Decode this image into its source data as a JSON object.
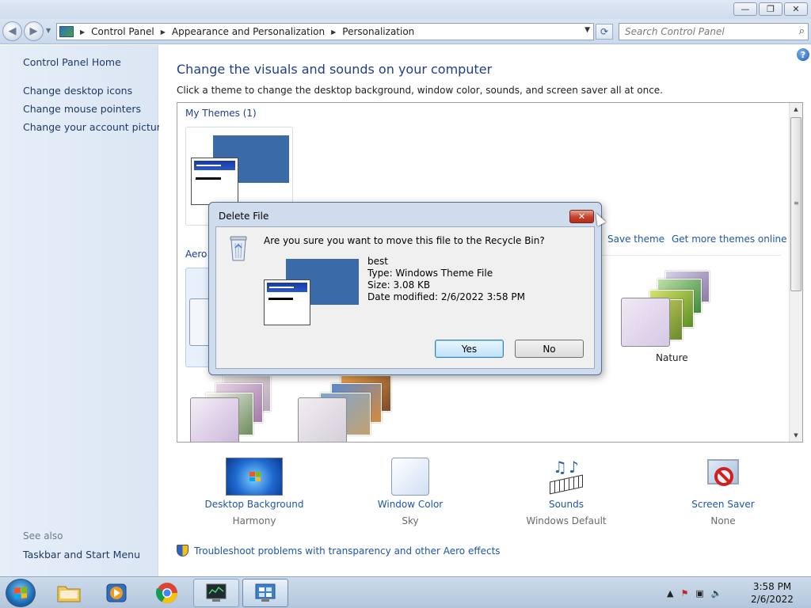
{
  "window": {
    "minimize_glyph": "—",
    "maximize_glyph": "❐",
    "close_glyph": "✕"
  },
  "address": {
    "crumbs": [
      "Control Panel",
      "Appearance and Personalization",
      "Personalization"
    ],
    "search_placeholder": "Search Control Panel"
  },
  "sidebar": {
    "home": "Control Panel Home",
    "links": [
      "Change desktop icons",
      "Change mouse pointers",
      "Change your account picture"
    ],
    "see_also_label": "See also",
    "see_also_links": [
      "Taskbar and Start Menu"
    ]
  },
  "main": {
    "help_glyph": "?",
    "title": "Change the visuals and sounds on your computer",
    "subtitle": "Click a theme to change the desktop background, window color, sounds, and screen saver all at once.",
    "my_themes_header": "My Themes (1)",
    "aero_header_partial": "Aero T",
    "save_theme": "Save theme",
    "get_more_themes": "Get more themes online",
    "nature_label": "Nature"
  },
  "bottom": [
    {
      "label": "Desktop Background",
      "value": "Harmony",
      "icon": "desktop-background-thumb"
    },
    {
      "label": "Window Color",
      "value": "Sky",
      "icon": "window-color-swatch"
    },
    {
      "label": "Sounds",
      "value": "Windows Default",
      "icon": "sounds-icon"
    },
    {
      "label": "Screen Saver",
      "value": "None",
      "icon": "screen-saver-icon"
    }
  ],
  "troubleshoot": "Troubleshoot problems with transparency and other Aero effects",
  "dialog": {
    "title": "Delete File",
    "question": "Are you sure you want to move this file to the Recycle Bin?",
    "file_name": "best",
    "file_type": "Type: Windows Theme File",
    "file_size": "Size: 3.08 KB",
    "file_modified": "Date modified: 2/6/2022 3:58 PM",
    "yes": "Yes",
    "no": "No",
    "close_glyph": "✕"
  },
  "taskbar": {
    "items": [
      "file-explorer",
      "media-player",
      "chrome",
      "system-monitor",
      "personalization"
    ],
    "active_item": "personalization",
    "time": "3:58 PM",
    "date": "2/6/2022"
  },
  "colors": {
    "link": "#1e56a8",
    "title_blue": "#1e3e8c",
    "theme_bg": "#3a6ba8"
  }
}
